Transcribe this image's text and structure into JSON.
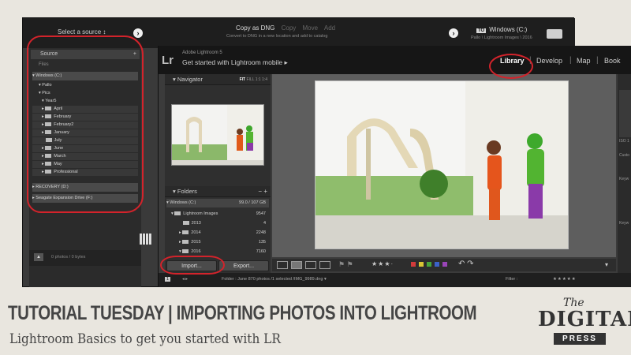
{
  "import_window": {
    "source_selector": "Select a source ↕",
    "modes": [
      "Copy as DNG",
      "Copy",
      "Move",
      "Add"
    ],
    "mode_subtitle": "Convert to DNG in a new location and add to catalog",
    "dest_tag": "TO",
    "destination": "Windows (C:)",
    "destination_sub": "Pallo \\ Lightroom Images \\ 2016",
    "source_header": "Source",
    "files_label": "Files",
    "tree": [
      {
        "label": "Windows (C:)",
        "kind": "drive"
      },
      {
        "label": "Pallo",
        "kind": "dir"
      },
      {
        "label": "Pics",
        "kind": "dir"
      },
      {
        "label": "Year5",
        "kind": "dir"
      },
      {
        "label": "April",
        "kind": "folder"
      },
      {
        "label": "February",
        "kind": "folder"
      },
      {
        "label": "February2",
        "kind": "folder"
      },
      {
        "label": "January",
        "kind": "folder"
      },
      {
        "label": "July",
        "kind": "folder"
      },
      {
        "label": "June",
        "kind": "folder"
      },
      {
        "label": "March",
        "kind": "folder"
      },
      {
        "label": "May",
        "kind": "folder"
      },
      {
        "label": "Professional",
        "kind": "folder"
      }
    ],
    "drives_bottom": [
      "RECOVERY (D:)",
      "Seagate Expansion Drive (F:)"
    ],
    "bytes_label": "0 photos / 0 bytes"
  },
  "lightroom": {
    "logo": "Lr",
    "app_name": "Adobe Lightroom 5",
    "mobile_prompt": "Get started with Lightroom mobile ▸",
    "modules": [
      "Library",
      "Develop",
      "Map",
      "Book"
    ],
    "navigator_title": "Navigator",
    "nav_options": [
      "FIT",
      "FILL",
      "1:1",
      "1:4"
    ],
    "folders_title": "Folders",
    "volume": {
      "label": "Windows (C:)",
      "size": "99.0 / 107 GB"
    },
    "folders": [
      {
        "label": "Lightroom Images",
        "count": "9547"
      },
      {
        "label": "2013",
        "count": "4"
      },
      {
        "label": "2014",
        "count": "2248"
      },
      {
        "label": "2015",
        "count": "135"
      },
      {
        "label": "2016",
        "count": "7160"
      }
    ],
    "import_label": "Import...",
    "export_label": "Export...",
    "filmstrip_page": "1",
    "filmstrip_text": "Folder : June    870 photos /1 selected /IMG_9989.dng ▾",
    "filter_label": "Filter :",
    "right_labels": [
      "ISO 1",
      "Custo",
      "Keyw",
      "Keyw"
    ]
  },
  "banner": {
    "title": "TUTORIAL TUESDAY | IMPORTING PHOTOS INTO LIGHTROOM",
    "subtitle": "Lightroom Basics to get you started with LR",
    "logo_the": "The",
    "logo_digital": "DIGITAL",
    "logo_press": "PRESS"
  },
  "colors": {
    "annotation_red": "#d3232b",
    "banner_text": "#454545"
  }
}
